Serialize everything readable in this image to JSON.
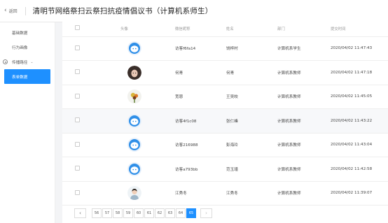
{
  "header": {
    "back_label": "返回",
    "title": "清明节网络祭扫云祭扫抗疫情倡议书（计算机系师生）"
  },
  "sidebar": {
    "items": [
      {
        "label": "基础数据",
        "type": "item"
      },
      {
        "label": "行为画像",
        "type": "item"
      },
      {
        "label": "传播路径",
        "type": "group"
      },
      {
        "label": "表单数据",
        "type": "item",
        "active": true
      }
    ]
  },
  "table": {
    "columns": [
      "头像",
      "微信昵称",
      "姓名",
      "部门",
      "提交时间"
    ],
    "rows": [
      {
        "avatar": "default",
        "nickname": "访客f6fa14",
        "name": "饶梓村",
        "dept": "计算机系学生",
        "time": "2020/04/02 11:47:43"
      },
      {
        "avatar": "photo-woman",
        "nickname": "何青",
        "name": "何青",
        "dept": "计算机系教师",
        "time": "2020/04/02 11:47:18"
      },
      {
        "avatar": "photo-flowers",
        "nickname": "宽恩",
        "name": "王吴皎",
        "dept": "计算机系教师",
        "time": "2020/04/02 11:45:05"
      },
      {
        "avatar": "default",
        "nickname": "访客4f1c08",
        "name": "张仁峰",
        "dept": "计算机系教师",
        "time": "2020/04/02 11:43:22"
      },
      {
        "avatar": "default",
        "nickname": "访客216988",
        "name": "彭海玲",
        "dept": "计算机系教师",
        "time": "2020/04/02 11:43:04"
      },
      {
        "avatar": "default",
        "nickname": "访客a793bb",
        "name": "范玉瑾",
        "dept": "计算机系教师",
        "time": "2020/04/02 11:42:58"
      },
      {
        "avatar": "photo-man",
        "nickname": "江秀冬",
        "name": "江秀冬",
        "dept": "计算机系教师",
        "time": "2020/04/02 11:39:07"
      }
    ]
  },
  "pagination": {
    "pages": [
      "56",
      "57",
      "58",
      "59",
      "60",
      "61",
      "62",
      "63",
      "64",
      "65"
    ],
    "current": "65",
    "prev_icon": "chevron-left-icon",
    "next_icon": "chevron-right-icon"
  },
  "colors": {
    "accent": "#1e90ff",
    "default_avatar": "#2f8fe8"
  }
}
